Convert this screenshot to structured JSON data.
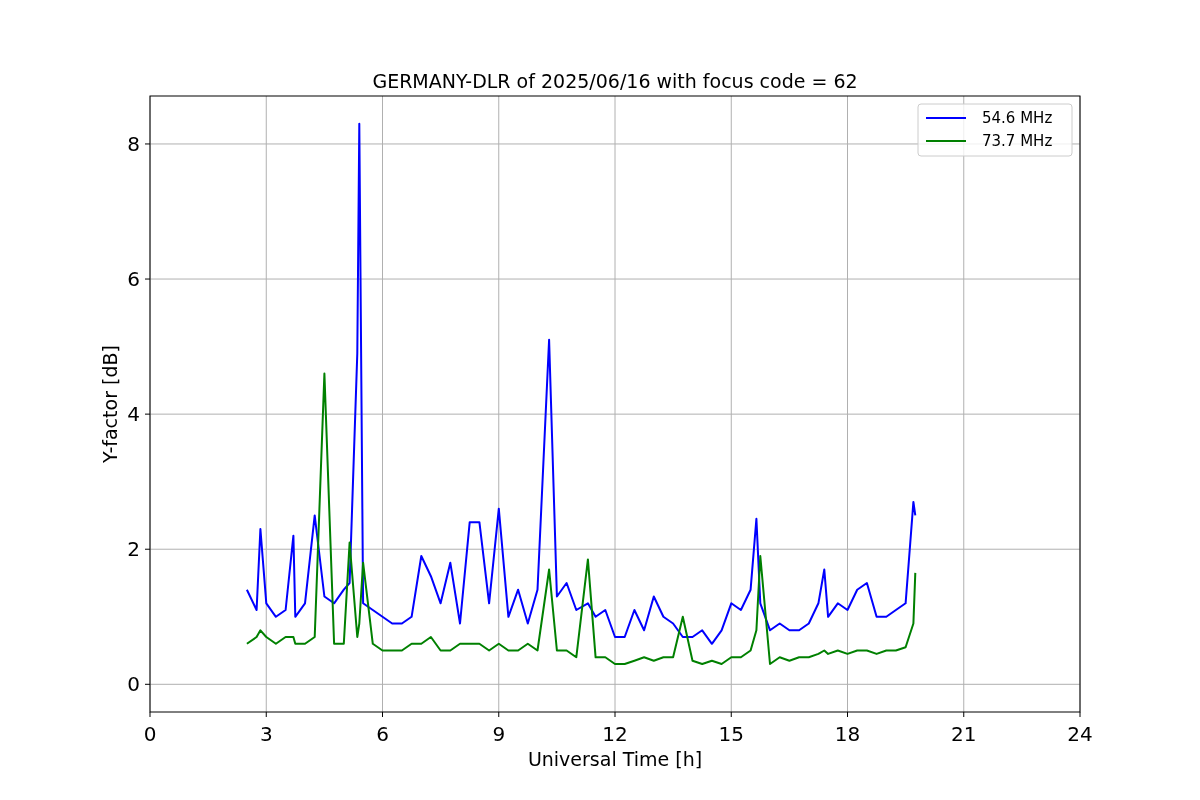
{
  "chart_data": {
    "type": "line",
    "title": "GERMANY-DLR of 2025/06/16 with focus code = 62",
    "xlabel": "Universal Time [h]",
    "ylabel": "Y-factor [dB]",
    "x": [
      2.5,
      2.75,
      2.85,
      3.0,
      3.25,
      3.5,
      3.7,
      3.75,
      4.0,
      4.25,
      4.5,
      4.75,
      5.0,
      5.15,
      5.35,
      5.4,
      5.5,
      5.75,
      6.0,
      6.25,
      6.5,
      6.75,
      7.0,
      7.25,
      7.5,
      7.75,
      8.0,
      8.25,
      8.5,
      8.75,
      9.0,
      9.25,
      9.5,
      9.75,
      10.0,
      10.3,
      10.5,
      10.75,
      11.0,
      11.3,
      11.5,
      11.75,
      12.0,
      12.25,
      12.5,
      12.75,
      13.0,
      13.25,
      13.5,
      13.75,
      14.0,
      14.25,
      14.5,
      14.75,
      15.0,
      15.25,
      15.5,
      15.65,
      15.75,
      16.0,
      16.25,
      16.5,
      16.75,
      17.0,
      17.25,
      17.4,
      17.5,
      17.75,
      18.0,
      18.25,
      18.5,
      18.75,
      19.0,
      19.25,
      19.5,
      19.7,
      19.75
    ],
    "series": [
      {
        "name": "54.6 MHz",
        "color": "#0000ff",
        "values": [
          1.4,
          1.1,
          2.3,
          1.2,
          1.0,
          1.1,
          2.2,
          1.0,
          1.2,
          2.5,
          1.3,
          1.2,
          1.4,
          1.5,
          4.9,
          8.3,
          1.2,
          1.1,
          1.0,
          0.9,
          0.9,
          1.0,
          1.9,
          1.6,
          1.2,
          1.8,
          0.9,
          2.4,
          2.4,
          1.2,
          2.6,
          1.0,
          1.4,
          0.9,
          1.4,
          5.1,
          1.3,
          1.5,
          1.1,
          1.2,
          1.0,
          1.1,
          0.7,
          0.7,
          1.1,
          0.8,
          1.3,
          1.0,
          0.9,
          0.7,
          0.7,
          0.8,
          0.6,
          0.8,
          1.2,
          1.1,
          1.4,
          2.45,
          1.2,
          0.8,
          0.9,
          0.8,
          0.8,
          0.9,
          1.2,
          1.7,
          1.0,
          1.2,
          1.1,
          1.4,
          1.5,
          1.0,
          1.0,
          1.1,
          1.2,
          2.7,
          2.5
        ]
      },
      {
        "name": "73.7 MHz",
        "color": "#008000",
        "values": [
          0.6,
          0.7,
          0.8,
          0.7,
          0.6,
          0.7,
          0.7,
          0.6,
          0.6,
          0.7,
          4.6,
          0.6,
          0.6,
          2.1,
          0.7,
          0.9,
          1.8,
          0.6,
          0.5,
          0.5,
          0.5,
          0.6,
          0.6,
          0.7,
          0.5,
          0.5,
          0.6,
          0.6,
          0.6,
          0.5,
          0.6,
          0.5,
          0.5,
          0.6,
          0.5,
          1.7,
          0.5,
          0.5,
          0.4,
          1.85,
          0.4,
          0.4,
          0.3,
          0.3,
          0.35,
          0.4,
          0.35,
          0.4,
          0.4,
          1.0,
          0.35,
          0.3,
          0.35,
          0.3,
          0.4,
          0.4,
          0.5,
          0.8,
          1.9,
          0.3,
          0.4,
          0.35,
          0.4,
          0.4,
          0.45,
          0.5,
          0.45,
          0.5,
          0.45,
          0.5,
          0.5,
          0.45,
          0.5,
          0.5,
          0.55,
          0.9,
          1.65
        ]
      }
    ],
    "grid": true,
    "legend": true,
    "xlim": [
      0,
      24
    ],
    "ylim": [
      -0.41,
      8.71
    ],
    "xticks": [
      0,
      3,
      6,
      9,
      12,
      15,
      18,
      21,
      24
    ],
    "yticks": [
      0,
      2,
      4,
      6,
      8
    ]
  }
}
